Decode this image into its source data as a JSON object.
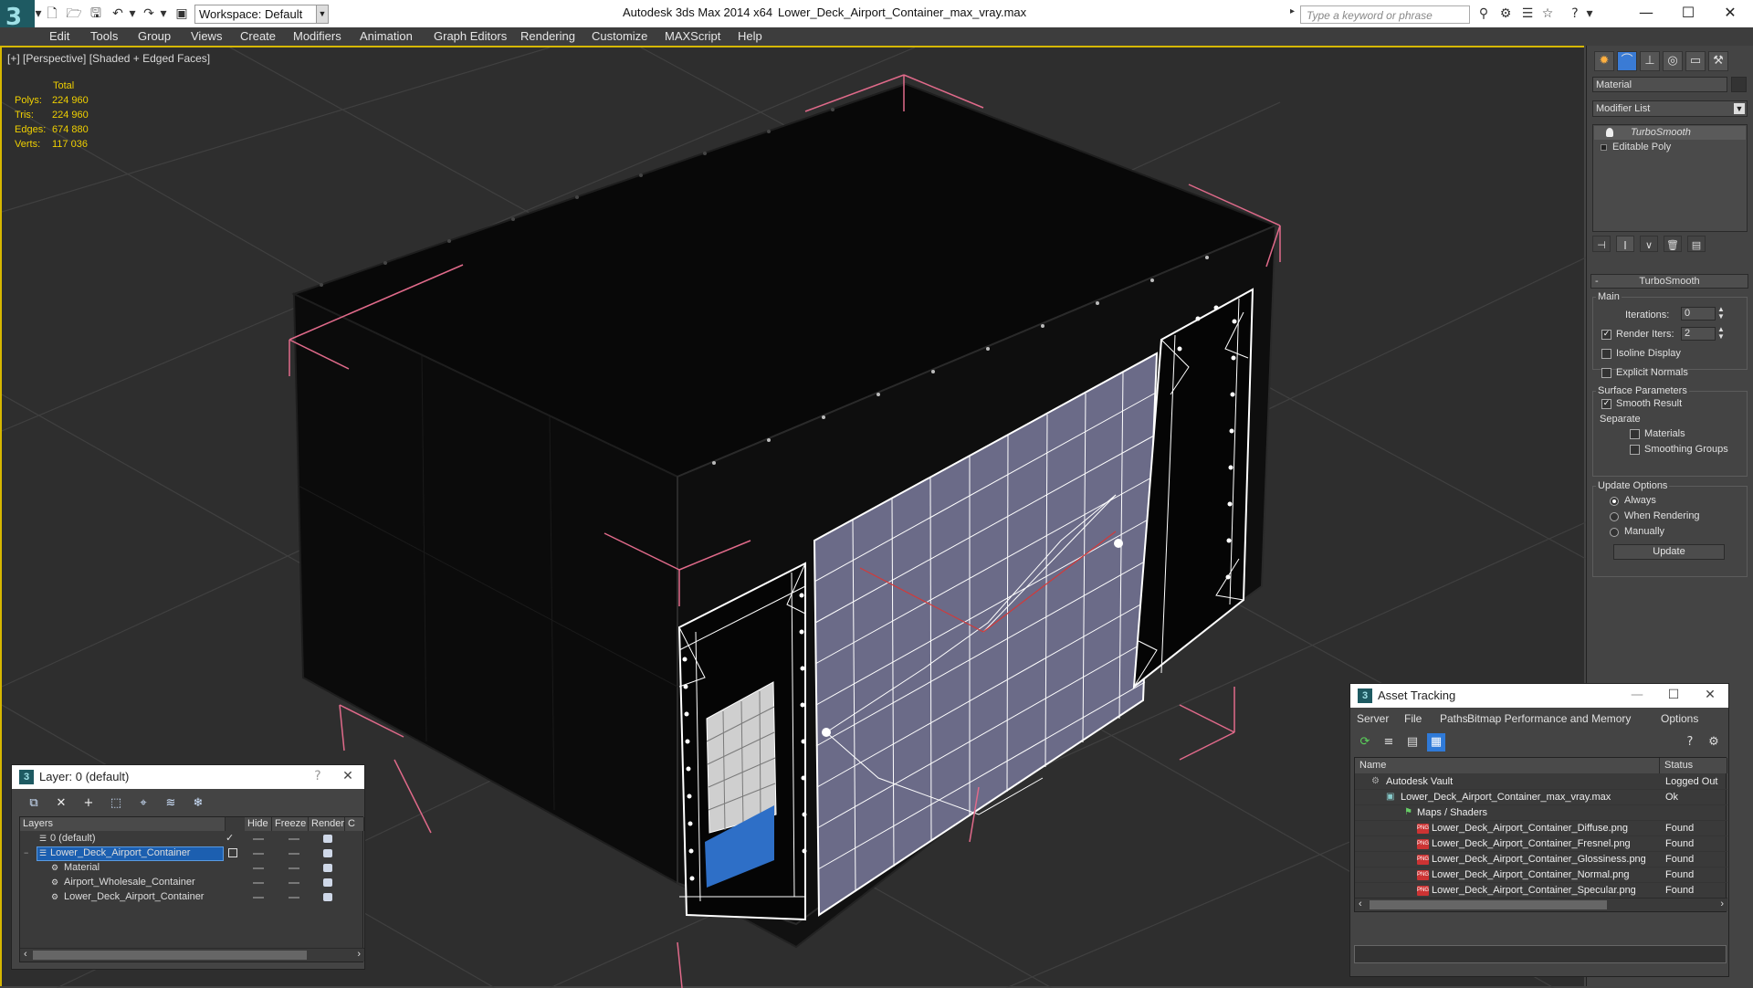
{
  "titlebar": {
    "app_title": "Autodesk 3ds Max  2014 x64",
    "file_title": "Lower_Deck_Airport_Container_max_vray.max",
    "workspace": "Workspace: Default",
    "search_placeholder": "Type a keyword or phrase",
    "window_controls": {
      "minimize": "—",
      "maximize": "☐",
      "close": "✕"
    }
  },
  "menu": [
    "Edit",
    "Tools",
    "Group",
    "Views",
    "Create",
    "Modifiers",
    "Animation",
    "Graph Editors",
    "Rendering",
    "Customize",
    "MAXScript",
    "Help"
  ],
  "viewport": {
    "label": "[+] [Perspective] [Shaded + Edged Faces]",
    "stats": {
      "header": "Total",
      "rows": [
        {
          "label": "Polys:",
          "value": "224 960"
        },
        {
          "label": "Tris:",
          "value": "224 960"
        },
        {
          "label": "Edges:",
          "value": "674 880"
        },
        {
          "label": "Verts:",
          "value": "117 036"
        }
      ]
    },
    "colors": {
      "selection": "#d6b700",
      "bbox": "#e06a8a",
      "grid": "#3e3e3e",
      "wire": "#ffffff",
      "panel": "#6a6a86"
    }
  },
  "command_panel": {
    "object_name": "Material",
    "modifier_list": "Modifier List",
    "stack": [
      "TurboSmooth",
      "Editable Poly"
    ],
    "rollout_title": "TurboSmooth",
    "main_group": "Main",
    "iterations_label": "Iterations:",
    "iterations_value": "0",
    "render_iters_label": "Render Iters:",
    "render_iters_value": "2",
    "isoline_label": "Isoline Display",
    "explicit_normals_label": "Explicit Normals",
    "surface_group": "Surface Parameters",
    "smooth_result_label": "Smooth Result",
    "separate_label": "Separate",
    "materials_label": "Materials",
    "smoothing_groups_label": "Smoothing Groups",
    "update_group": "Update Options",
    "always_label": "Always",
    "when_rendering_label": "When Rendering",
    "manually_label": "Manually",
    "update_button": "Update"
  },
  "layer_window": {
    "title": "Layer: 0 (default)",
    "help": "?",
    "close": "✕",
    "columns": [
      "Layers",
      "Hide",
      "Freeze",
      "Render",
      "C"
    ],
    "rows": [
      {
        "name": "0 (default)",
        "indent": 1,
        "selected": false
      },
      {
        "name": "Lower_Deck_Airport_Container",
        "indent": 1,
        "selected": true
      },
      {
        "name": "Material",
        "indent": 2,
        "selected": false
      },
      {
        "name": "Airport_Wholesale_Container",
        "indent": 2,
        "selected": false
      },
      {
        "name": "Lower_Deck_Airport_Container",
        "indent": 2,
        "selected": false
      }
    ]
  },
  "asset_window": {
    "title": "Asset Tracking",
    "menu": [
      "Server",
      "File",
      "Paths",
      "Bitmap Performance and Memory",
      "Options"
    ],
    "columns": [
      "Name",
      "Status"
    ],
    "rows": [
      {
        "name": "Autodesk Vault",
        "status": "Logged Out",
        "indent": 0,
        "icon": "vault"
      },
      {
        "name": "Lower_Deck_Airport_Container_max_vray.max",
        "status": "Ok",
        "indent": 1,
        "icon": "max"
      },
      {
        "name": "Maps / Shaders",
        "status": "",
        "indent": 2,
        "icon": "folder"
      },
      {
        "name": "Lower_Deck_Airport_Container_Diffuse.png",
        "status": "Found",
        "indent": 3,
        "icon": "png"
      },
      {
        "name": "Lower_Deck_Airport_Container_Fresnel.png",
        "status": "Found",
        "indent": 3,
        "icon": "png"
      },
      {
        "name": "Lower_Deck_Airport_Container_Glossiness.png",
        "status": "Found",
        "indent": 3,
        "icon": "png"
      },
      {
        "name": "Lower_Deck_Airport_Container_Normal.png",
        "status": "Found",
        "indent": 3,
        "icon": "png"
      },
      {
        "name": "Lower_Deck_Airport_Container_Specular.png",
        "status": "Found",
        "indent": 3,
        "icon": "png"
      }
    ]
  }
}
